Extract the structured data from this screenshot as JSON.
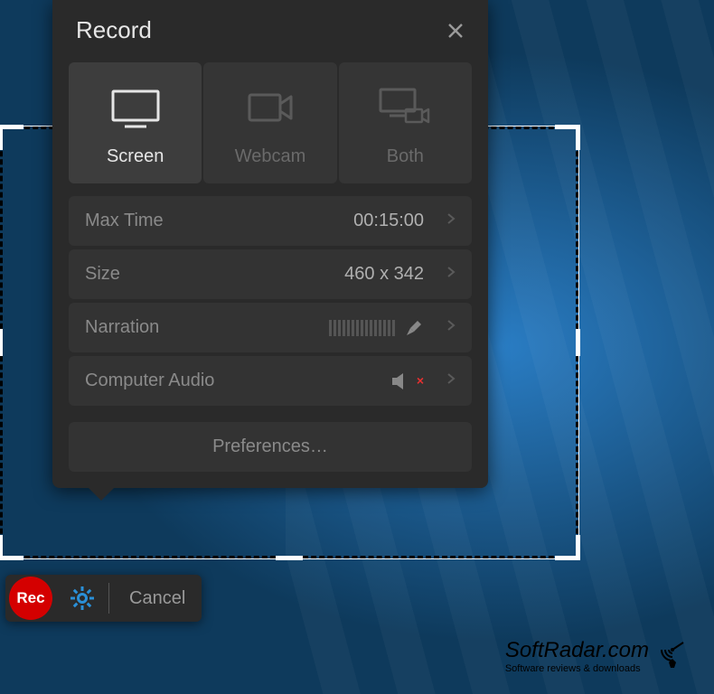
{
  "panel": {
    "title": "Record",
    "tabs": {
      "screen": "Screen",
      "webcam": "Webcam",
      "both": "Both"
    },
    "rows": {
      "maxtime": {
        "label": "Max Time",
        "value": "00:15:00"
      },
      "size": {
        "label": "Size",
        "value": "460 x 342"
      },
      "narration": {
        "label": "Narration"
      },
      "computer_audio": {
        "label": "Computer Audio"
      }
    },
    "preferences": "Preferences…"
  },
  "toolbar": {
    "rec": "Rec",
    "cancel": "Cancel"
  },
  "watermark": {
    "main": "SoftRadar.com",
    "sub": "Software reviews & downloads"
  }
}
